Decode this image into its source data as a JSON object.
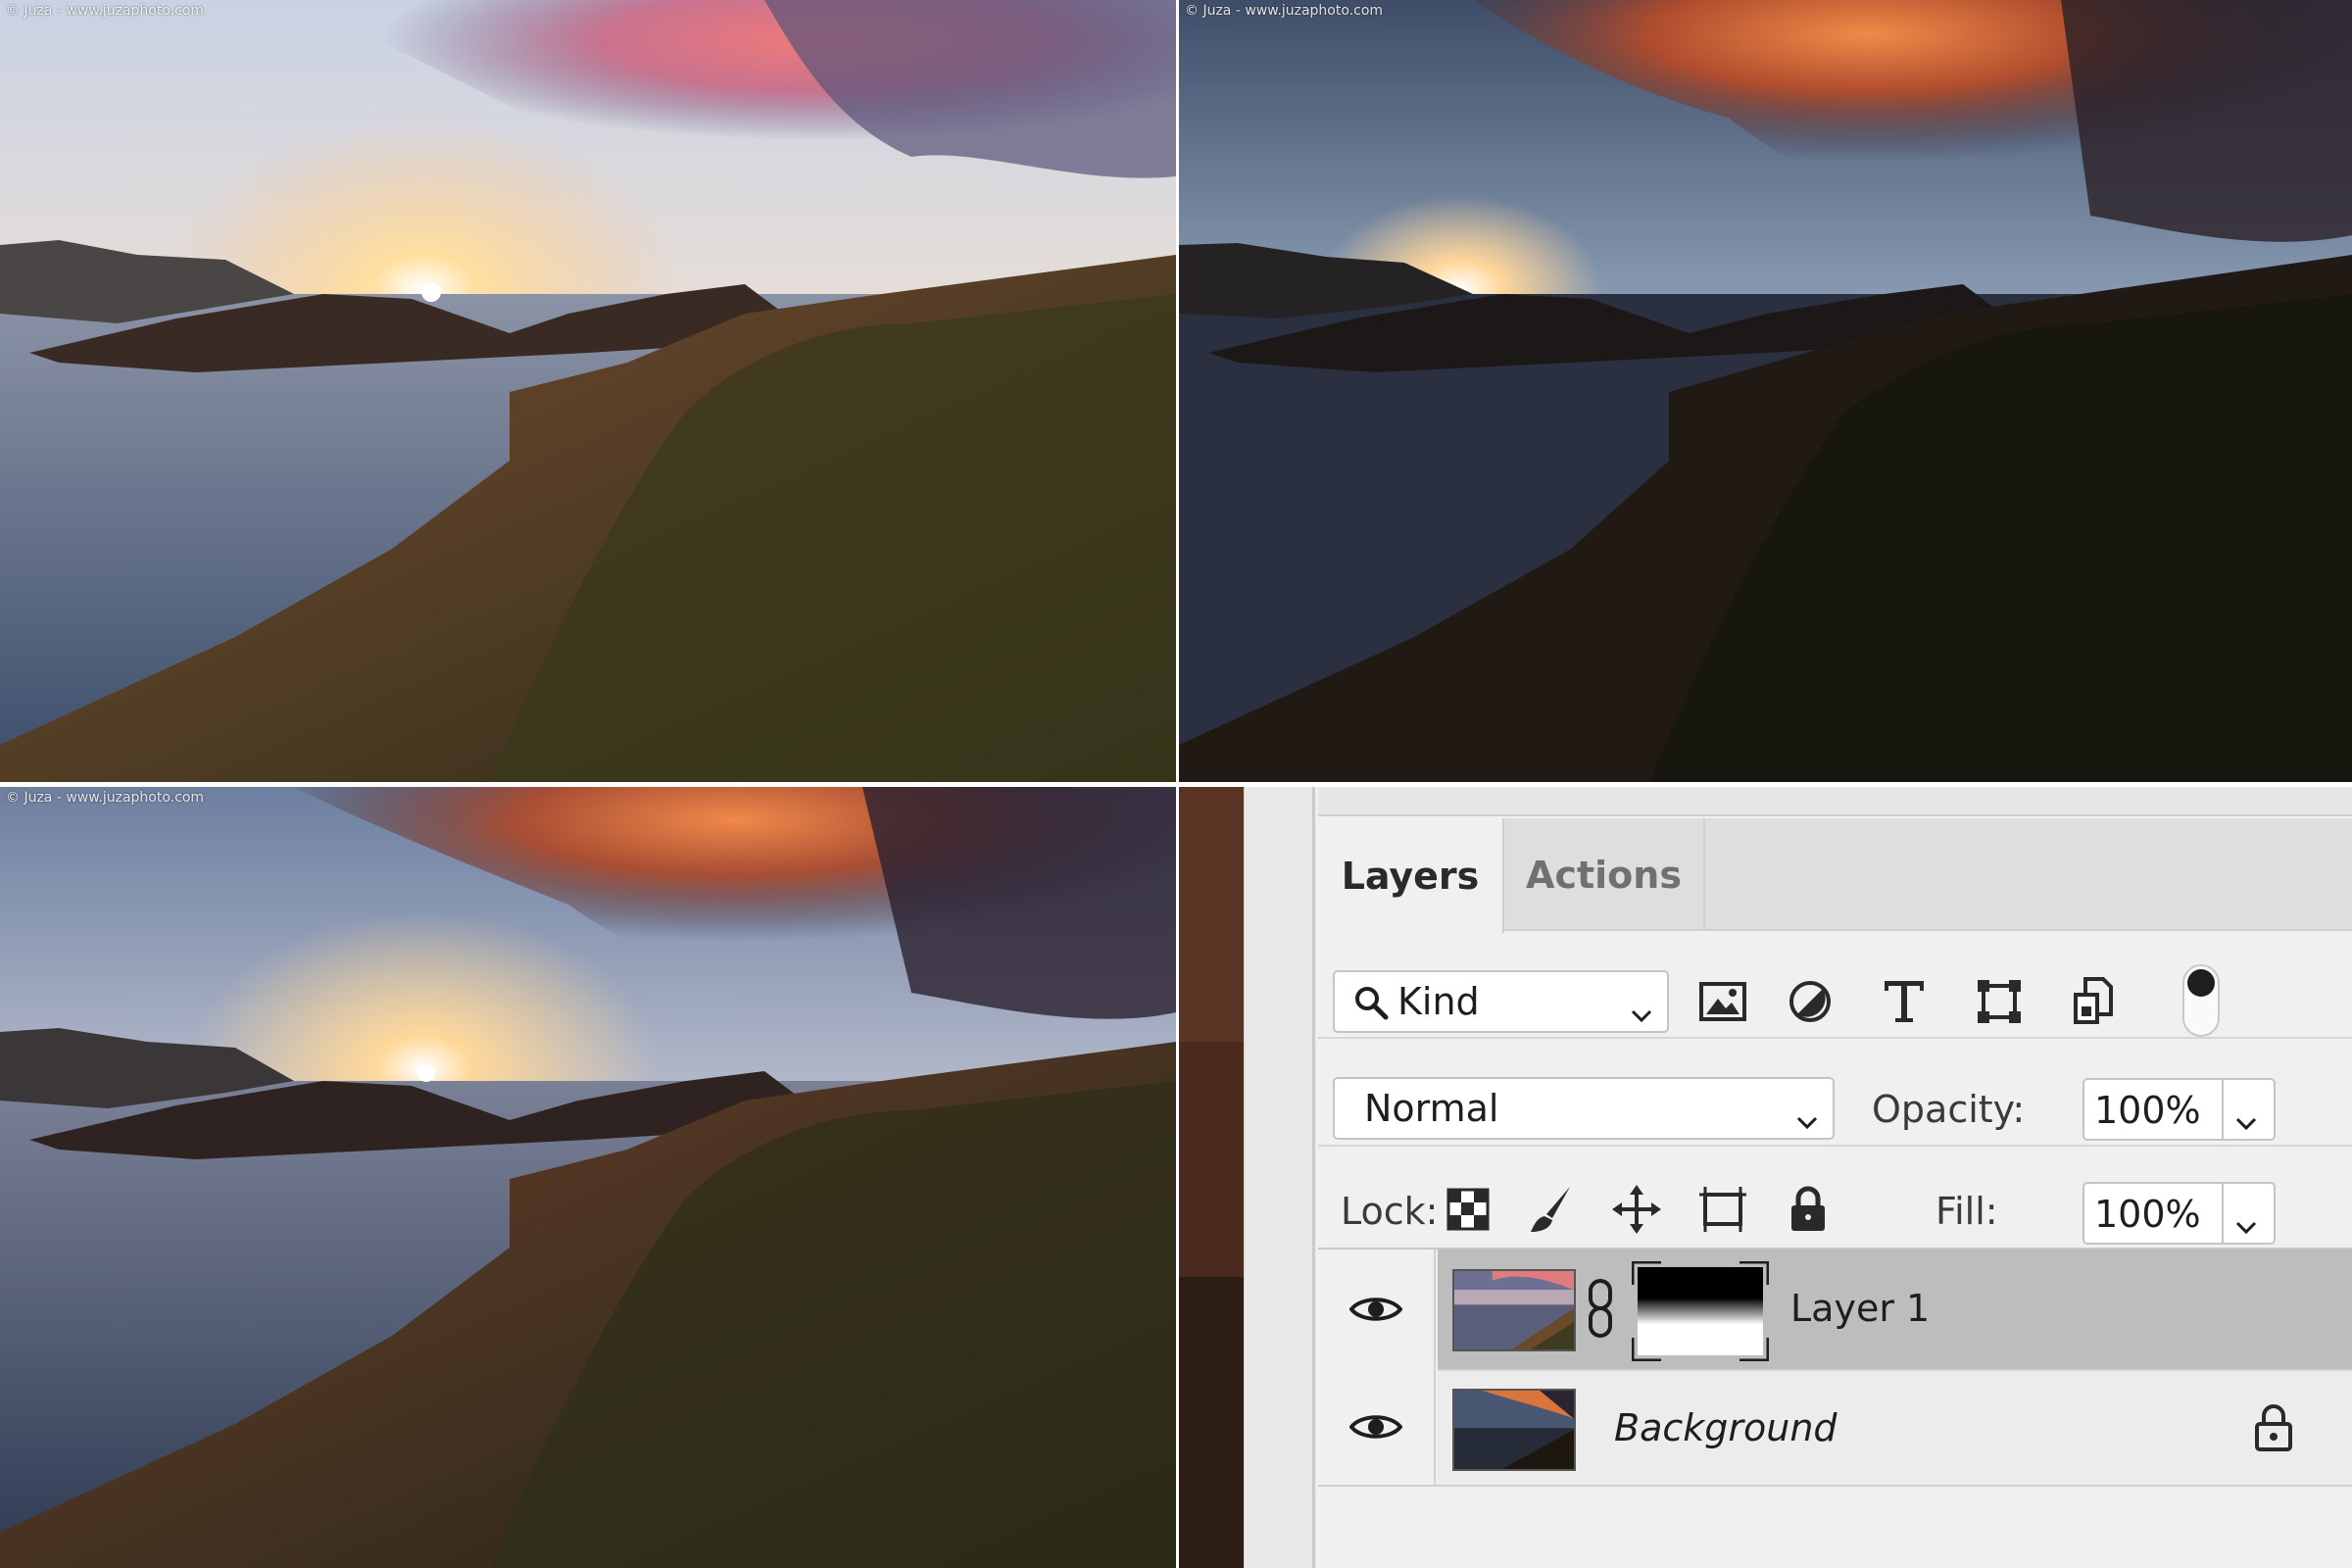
{
  "photos": {
    "watermark": "© Juza - www.juzaphoto.com"
  },
  "panel": {
    "tabs": [
      {
        "label": "Layers",
        "active": true
      },
      {
        "label": "Actions",
        "active": false
      }
    ],
    "filter": {
      "kind_label": "Kind",
      "icons": [
        "image-filter-icon",
        "adjustment-filter-icon",
        "type-filter-icon",
        "shape-filter-icon",
        "smart-object-filter-icon"
      ]
    },
    "blend": {
      "mode": "Normal",
      "opacity_label": "Opacity:",
      "opacity_value": "100%"
    },
    "lock": {
      "label": "Lock:",
      "icons": [
        "lock-transparent-icon",
        "lock-image-icon",
        "lock-position-icon",
        "lock-artboard-icon",
        "lock-all-icon"
      ],
      "fill_label": "Fill:",
      "fill_value": "100%"
    },
    "layers": [
      {
        "name": "Layer 1",
        "visible": true,
        "selected": true,
        "has_mask": true
      },
      {
        "name": "Background",
        "visible": true,
        "selected": false,
        "locked": true
      }
    ]
  },
  "colors": {
    "panel_bg": "#f0f0f0",
    "selected_layer": "#bdbdbd",
    "tab_inactive_text": "#707070"
  }
}
